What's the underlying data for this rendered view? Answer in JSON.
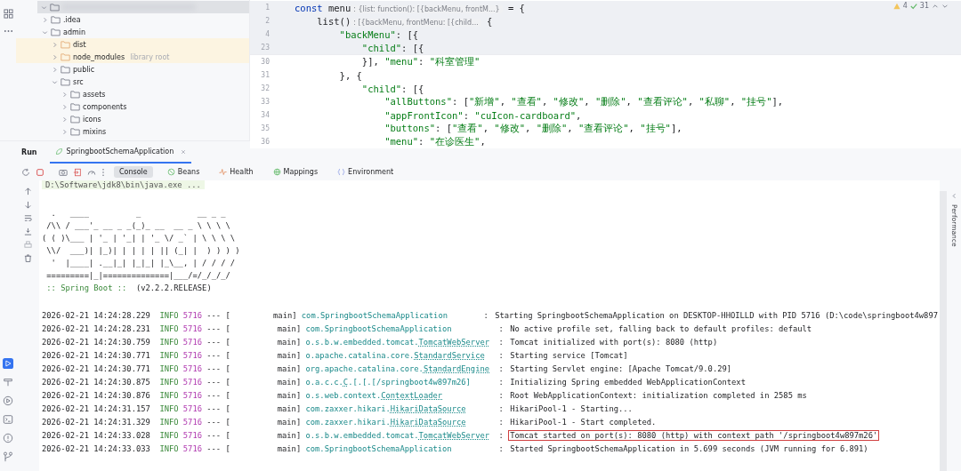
{
  "project": {
    "items": [
      {
        "redacted": true,
        "expanded": true,
        "children": [
          {
            "name": ".idea",
            "expanded": false,
            "highlighted": false
          },
          {
            "name": "admin",
            "expanded": true,
            "highlighted": false,
            "children": [
              {
                "name": "dist",
                "expanded": false,
                "highlighted": true
              },
              {
                "name": "node_modules",
                "note": "library root",
                "expanded": false,
                "highlighted": true
              },
              {
                "name": "public",
                "expanded": false,
                "highlighted": false
              },
              {
                "name": "src",
                "expanded": true,
                "highlighted": false,
                "children": [
                  {
                    "name": "assets",
                    "expanded": false,
                    "highlighted": false
                  },
                  {
                    "name": "components",
                    "expanded": false,
                    "highlighted": false
                  },
                  {
                    "name": "icons",
                    "expanded": false,
                    "highlighted": false
                  },
                  {
                    "name": "mixins",
                    "expanded": false,
                    "highlighted": false
                  }
                ]
              }
            ]
          }
        ]
      }
    ]
  },
  "editor": {
    "warnings": "4",
    "checks": "31",
    "lines": [
      {
        "number": "1",
        "sticky": true,
        "tokens": [
          {
            "kind": "keyword",
            "text": "const "
          },
          {
            "kind": "plain",
            "text": "menu"
          },
          {
            "kind": "hint",
            "text": ": {list: function(): [{backMenu, frontM...}"
          },
          {
            "kind": "plain",
            "text": " = {"
          }
        ]
      },
      {
        "number": "2",
        "sticky": true,
        "tokens": [
          {
            "kind": "plain",
            "text": "    list()"
          },
          {
            "kind": "hint",
            "text": ": [{backMenu, frontMenu: [{child..."
          },
          {
            "kind": "plain",
            "text": " {"
          }
        ]
      },
      {
        "number": "4",
        "sticky": true,
        "tokens": [
          {
            "kind": "string",
            "text": "        \"backMenu\""
          },
          {
            "kind": "plain",
            "text": ": [{"
          }
        ]
      },
      {
        "number": "23",
        "sticky": true,
        "tokens": [
          {
            "kind": "string",
            "text": "            \"child\""
          },
          {
            "kind": "plain",
            "text": ": [{"
          }
        ]
      },
      {
        "number": "30",
        "sticky": false,
        "tokens": [
          {
            "kind": "plain",
            "text": "            }], "
          },
          {
            "kind": "string",
            "text": "\"menu\""
          },
          {
            "kind": "plain",
            "text": ": "
          },
          {
            "kind": "string",
            "text": "\"科室管理\""
          }
        ]
      },
      {
        "number": "31",
        "sticky": false,
        "tokens": [
          {
            "kind": "plain",
            "text": "        }, {"
          }
        ]
      },
      {
        "number": "32",
        "sticky": false,
        "tokens": [
          {
            "kind": "string",
            "text": "            \"child\""
          },
          {
            "kind": "plain",
            "text": ": [{"
          }
        ]
      },
      {
        "number": "33",
        "sticky": false,
        "tokens": [
          {
            "kind": "string",
            "text": "                \"allButtons\""
          },
          {
            "kind": "plain",
            "text": ": ["
          },
          {
            "kind": "string",
            "text": "\"新增\""
          },
          {
            "kind": "plain",
            "text": ", "
          },
          {
            "kind": "string",
            "text": "\"查看\""
          },
          {
            "kind": "plain",
            "text": ", "
          },
          {
            "kind": "string",
            "text": "\"修改\""
          },
          {
            "kind": "plain",
            "text": ", "
          },
          {
            "kind": "string",
            "text": "\"删除\""
          },
          {
            "kind": "plain",
            "text": ", "
          },
          {
            "kind": "string",
            "text": "\"查看评论\""
          },
          {
            "kind": "plain",
            "text": ", "
          },
          {
            "kind": "string",
            "text": "\"私聊\""
          },
          {
            "kind": "plain",
            "text": ", "
          },
          {
            "kind": "string",
            "text": "\"挂号\""
          },
          {
            "kind": "plain",
            "text": "],"
          }
        ]
      },
      {
        "number": "34",
        "sticky": false,
        "tokens": [
          {
            "kind": "string",
            "text": "                \"appFrontIcon\""
          },
          {
            "kind": "plain",
            "text": ": "
          },
          {
            "kind": "string",
            "text": "\"cuIcon-cardboard\""
          },
          {
            "kind": "plain",
            "text": ","
          }
        ]
      },
      {
        "number": "35",
        "sticky": false,
        "tokens": [
          {
            "kind": "string",
            "text": "                \"buttons\""
          },
          {
            "kind": "plain",
            "text": ": ["
          },
          {
            "kind": "string",
            "text": "\"查看\""
          },
          {
            "kind": "plain",
            "text": ", "
          },
          {
            "kind": "string",
            "text": "\"修改\""
          },
          {
            "kind": "plain",
            "text": ", "
          },
          {
            "kind": "string",
            "text": "\"删除\""
          },
          {
            "kind": "plain",
            "text": ", "
          },
          {
            "kind": "string",
            "text": "\"查看评论\""
          },
          {
            "kind": "plain",
            "text": ", "
          },
          {
            "kind": "string",
            "text": "\"挂号\""
          },
          {
            "kind": "plain",
            "text": "],"
          }
        ]
      },
      {
        "number": "36",
        "sticky": false,
        "tokens": [
          {
            "kind": "string",
            "text": "                \"menu\""
          },
          {
            "kind": "plain",
            "text": ": "
          },
          {
            "kind": "string",
            "text": "\"在诊医生\""
          },
          {
            "kind": "plain",
            "text": ","
          }
        ]
      }
    ]
  },
  "run": {
    "label": "Run",
    "tab": "SpringbootSchemaApplication",
    "tabs": [
      {
        "label": "Console",
        "kind": "console",
        "selected": true
      },
      {
        "label": "Beans",
        "kind": "beans",
        "selected": false
      },
      {
        "label": "Health",
        "kind": "health",
        "selected": false
      },
      {
        "label": "Mappings",
        "kind": "mappings",
        "selected": false
      },
      {
        "label": "Environment",
        "kind": "environment",
        "selected": false
      }
    ],
    "command": "D:\\Software\\jdk8\\bin\\java.exe ...",
    "banner": [
      "  .   ____          _            __ _ _",
      " /\\\\ / ___'_ __ _ _(_)_ __  __ _ \\ \\ \\ \\",
      "( ( )\\___ | '_ | '_| | '_ \\/ _` | \\ \\ \\ \\",
      " \\\\/  ___)| |_)| | | | | || (_| |  ) ) ) )",
      "  '  |____| .__|_| |_|_| |_\\__, | / / / /",
      " =========|_|==============|___/=/_/_/_/"
    ],
    "boot_label": " :: Spring Boot :: ",
    "boot_version": "(v2.2.2.RELEASE)",
    "rows": [
      {
        "time": "2026-02-21 14:24:28.229",
        "level": "INFO",
        "pid": "5716",
        "sep": "--- [",
        "thread": "main]",
        "logger": [
          {
            "text": "com.SpringbootSchemaApplication",
            "link": false
          }
        ],
        "colon": ":",
        "message": "Starting SpringbootSchemaApplication on DESKTOP-HHOILLD with PID 5716 (D:\\code\\springboot4w897",
        "highlighted": false
      },
      {
        "time": "2026-02-21 14:24:28.231",
        "level": "INFO",
        "pid": "5716",
        "sep": "--- [",
        "thread": "main]",
        "logger": [
          {
            "text": "com.SpringbootSchemaApplication",
            "link": false
          }
        ],
        "colon": ":",
        "message": "No active profile set, falling back to default profiles: default",
        "highlighted": false
      },
      {
        "time": "2026-02-21 14:24:30.759",
        "level": "INFO",
        "pid": "5716",
        "sep": "--- [",
        "thread": "main]",
        "logger": [
          {
            "text": "o.s.b.w.embedded.tomcat.",
            "link": false
          },
          {
            "text": "TomcatWebServer",
            "link": true
          }
        ],
        "colon": ":",
        "message": "Tomcat initialized with port(s): 8080 (http)",
        "highlighted": false
      },
      {
        "time": "2026-02-21 14:24:30.771",
        "level": "INFO",
        "pid": "5716",
        "sep": "--- [",
        "thread": "main]",
        "logger": [
          {
            "text": "o.apache.catalina.core.",
            "link": false
          },
          {
            "text": "StandardService",
            "link": true
          }
        ],
        "colon": ":",
        "message": "Starting service [Tomcat]",
        "highlighted": false
      },
      {
        "time": "2026-02-21 14:24:30.771",
        "level": "INFO",
        "pid": "5716",
        "sep": "--- [",
        "thread": "main]",
        "logger": [
          {
            "text": "org.apache.catalina.core.",
            "link": false
          },
          {
            "text": "StandardEngine",
            "link": true
          }
        ],
        "colon": ":",
        "message": "Starting Servlet engine: [Apache Tomcat/9.0.29]",
        "highlighted": false
      },
      {
        "time": "2026-02-21 14:24:30.875",
        "level": "INFO",
        "pid": "5716",
        "sep": "--- [",
        "thread": "main]",
        "logger": [
          {
            "text": "o.a.c.c.",
            "link": false
          },
          {
            "text": "C",
            "link": true
          },
          {
            "text": ".[.[.[/springboot4w897m26]",
            "link": false
          }
        ],
        "colon": ":",
        "message": "Initializing Spring embedded WebApplicationContext",
        "highlighted": false
      },
      {
        "time": "2026-02-21 14:24:30.876",
        "level": "INFO",
        "pid": "5716",
        "sep": "--- [",
        "thread": "main]",
        "logger": [
          {
            "text": "o.s.web.context.",
            "link": false
          },
          {
            "text": "ContextLoader",
            "link": true
          }
        ],
        "colon": ":",
        "message": "Root WebApplicationContext: initialization completed in 2585 ms",
        "highlighted": false
      },
      {
        "time": "2026-02-21 14:24:31.157",
        "level": "INFO",
        "pid": "5716",
        "sep": "--- [",
        "thread": "main]",
        "logger": [
          {
            "text": "com.zaxxer.hikari.",
            "link": false
          },
          {
            "text": "HikariDataSource",
            "link": true
          }
        ],
        "colon": ":",
        "message": "HikariPool-1 - Starting...",
        "highlighted": false
      },
      {
        "time": "2026-02-21 14:24:31.329",
        "level": "INFO",
        "pid": "5716",
        "sep": "--- [",
        "thread": "main]",
        "logger": [
          {
            "text": "com.zaxxer.hikari.",
            "link": false
          },
          {
            "text": "HikariDataSource",
            "link": true
          }
        ],
        "colon": ":",
        "message": "HikariPool-1 - Start completed.",
        "highlighted": false
      },
      {
        "time": "2026-02-21 14:24:33.028",
        "level": "INFO",
        "pid": "5716",
        "sep": "--- [",
        "thread": "main]",
        "logger": [
          {
            "text": "o.s.b.w.embedded.tomcat.",
            "link": false
          },
          {
            "text": "TomcatWebServer",
            "link": true
          }
        ],
        "colon": ":",
        "message": "Tomcat started on port(s): 8080 (http) with context path '/springboot4w897m26'",
        "highlighted": true
      },
      {
        "time": "2026-02-21 14:24:33.033",
        "level": "INFO",
        "pid": "5716",
        "sep": "--- [",
        "thread": "main]",
        "logger": [
          {
            "text": "com.SpringbootSchemaApplication",
            "link": false
          }
        ],
        "colon": ":",
        "message": "Started SpringbootSchemaApplication in 5.699 seconds (JVM running for 6.891)",
        "highlighted": false
      }
    ]
  },
  "side_panel": {
    "label": "Performance"
  }
}
